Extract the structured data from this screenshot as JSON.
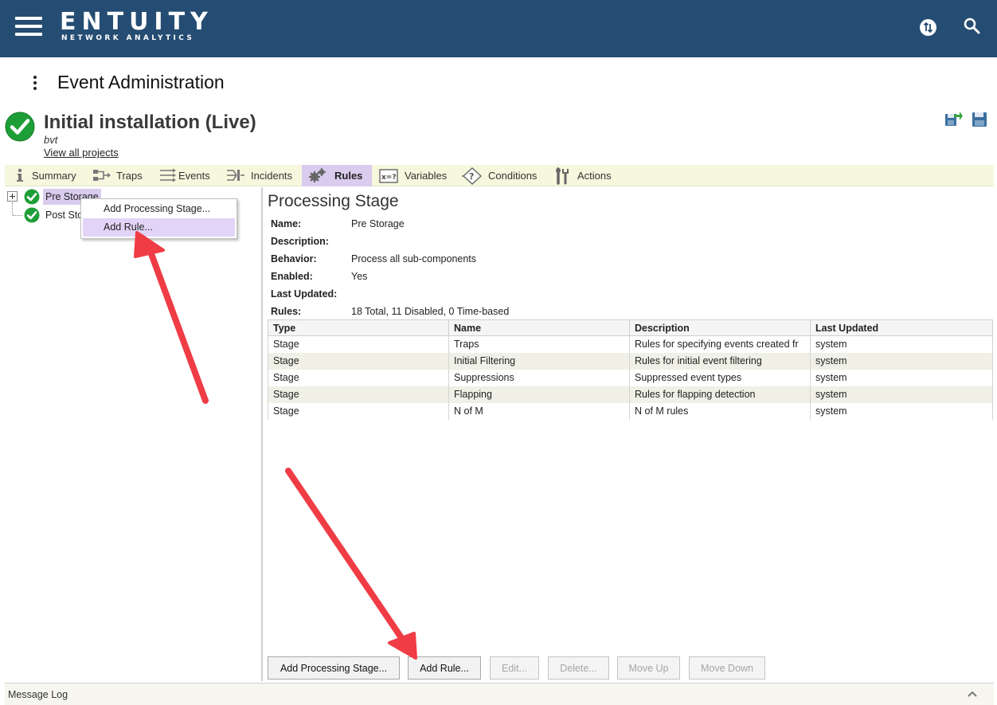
{
  "header": {
    "logo_main": "ENTUITY",
    "logo_sub": "NETWORK ANALYTICS"
  },
  "page": {
    "title": "Event Administration"
  },
  "project": {
    "title": "Initial installation (Live)",
    "user": "bvt",
    "view_all_link": "View all projects"
  },
  "tabs": [
    {
      "label": "Summary",
      "icon": "info-icon"
    },
    {
      "label": "Traps",
      "icon": "traps-icon"
    },
    {
      "label": "Events",
      "icon": "events-icon"
    },
    {
      "label": "Incidents",
      "icon": "incidents-icon"
    },
    {
      "label": "Rules",
      "icon": "gears-icon",
      "active": true
    },
    {
      "label": "Variables",
      "icon": "variables-icon"
    },
    {
      "label": "Conditions",
      "icon": "conditions-icon"
    },
    {
      "label": "Actions",
      "icon": "tools-icon"
    }
  ],
  "tree": {
    "nodes": [
      {
        "label": "Pre Storage",
        "selected": true
      },
      {
        "label": "Post Sto"
      }
    ]
  },
  "context_menu": {
    "items": [
      {
        "label": "Add Processing Stage..."
      },
      {
        "label": "Add Rule...",
        "hover": true
      }
    ]
  },
  "details": {
    "title": "Processing Stage",
    "properties": [
      {
        "key": "Name:",
        "value": "Pre Storage"
      },
      {
        "key": "Description:",
        "value": ""
      },
      {
        "key": "Behavior:",
        "value": "Process all sub-components"
      },
      {
        "key": "Enabled:",
        "value": "Yes"
      },
      {
        "key": "Last Updated:",
        "value": ""
      },
      {
        "key": "Rules:",
        "value": "18 Total, 11 Disabled, 0 Time-based"
      }
    ],
    "table": {
      "columns": [
        "Type",
        "Name",
        "Description",
        "Last Updated"
      ],
      "rows": [
        [
          "Stage",
          "Traps",
          "Rules for specifying events created fr",
          "system"
        ],
        [
          "Stage",
          "Initial Filtering",
          "Rules for initial event filtering",
          "system"
        ],
        [
          "Stage",
          "Suppressions",
          "Suppressed event types",
          "system"
        ],
        [
          "Stage",
          "Flapping",
          "Rules for flapping detection",
          "system"
        ],
        [
          "Stage",
          "N of M",
          "N of M rules",
          "system"
        ]
      ]
    }
  },
  "buttons": {
    "add_stage": "Add Processing Stage...",
    "add_rule": "Add Rule...",
    "edit": "Edit...",
    "delete": "Delete...",
    "move_up": "Move Up",
    "move_down": "Move Down"
  },
  "message_log": {
    "label": "Message Log"
  },
  "colors": {
    "header_bg": "#254d73",
    "tab_bar_bg": "#f6f7dd",
    "selection": "#d9ccee",
    "check_green": "#1e9e37",
    "annotation_arrow": "#ef3c45"
  }
}
